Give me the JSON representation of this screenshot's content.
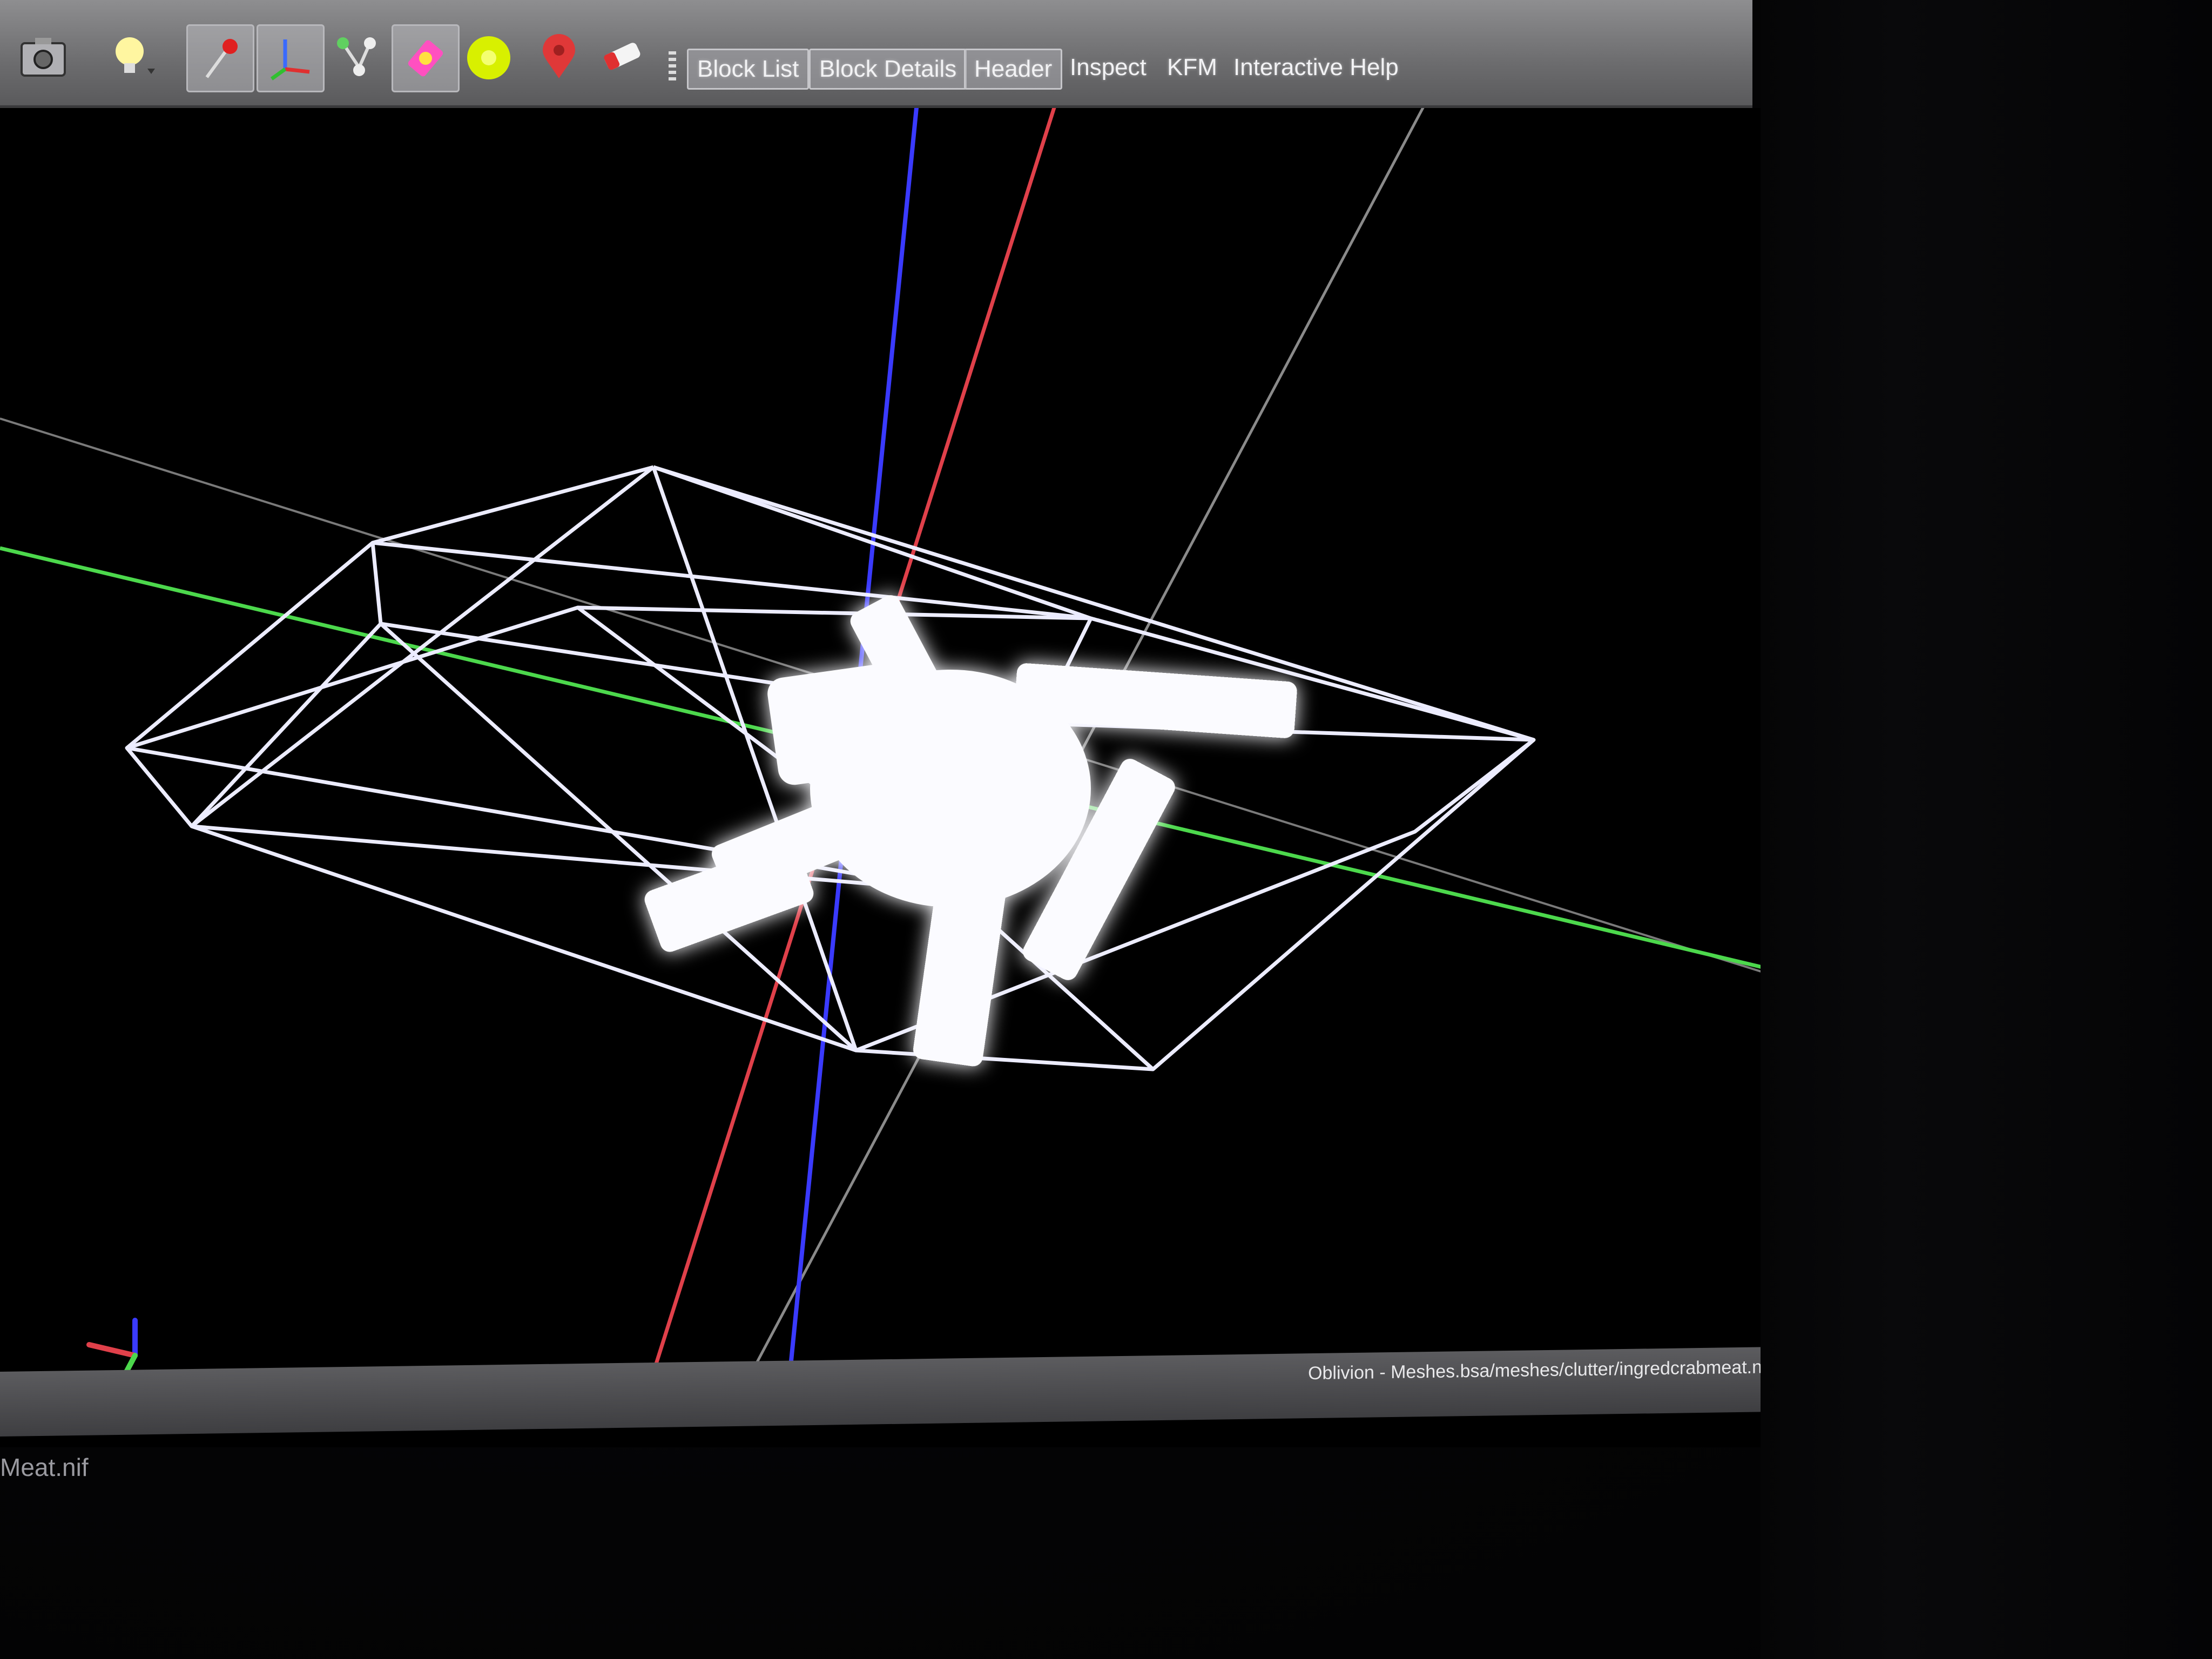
{
  "toolbar": {
    "icons": [
      {
        "name": "screenshot-icon",
        "active": false
      },
      {
        "name": "lightbulb-icon",
        "active": false
      },
      {
        "name": "select-pin-icon",
        "active": true
      },
      {
        "name": "axes-icon",
        "active": true
      },
      {
        "name": "node-tree-icon",
        "active": false
      },
      {
        "name": "highlight-icon",
        "active": true
      },
      {
        "name": "sphere-icon",
        "active": false
      },
      {
        "name": "map-pin-icon",
        "active": false
      },
      {
        "name": "eraser-icon",
        "active": false
      }
    ],
    "buttons": {
      "block_list": "Block List",
      "block_details": "Block Details",
      "header": "Header",
      "inspect": "Inspect",
      "kfm": "KFM",
      "interactive_help": "Interactive Help"
    }
  },
  "viewport": {
    "axis_colors": {
      "x": "#e0404a",
      "y": "#4cd84c",
      "z": "#3a3aff"
    },
    "wireframe_color": "#e8e8ff",
    "background": "#000000"
  },
  "status_bar": {
    "path": "Oblivion - Meshes.bsa/meshes/clutter/ingredcrabmeat.nif"
  },
  "bottom_file": "Meat.nif"
}
